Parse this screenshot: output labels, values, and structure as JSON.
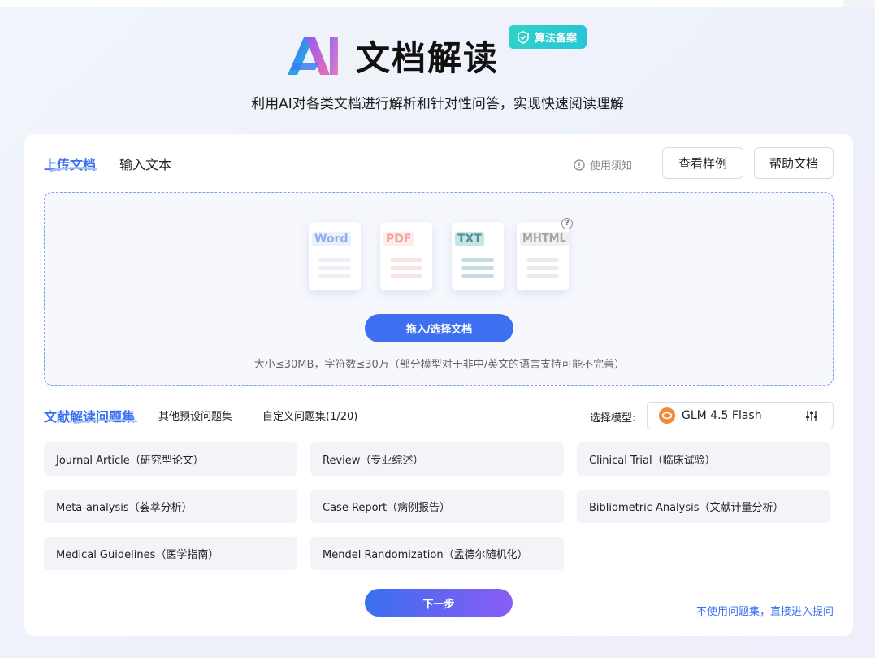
{
  "header": {
    "title": "文档解读",
    "badge": "算法备案",
    "subtitle": "利用AI对各类文档进行解析和针对性问答，实现快速阅读理解"
  },
  "tabs": {
    "upload": "上传文档",
    "input_text": "输入文本"
  },
  "toolbar": {
    "notice": "使用须知",
    "examples": "查看样例",
    "help": "帮助文档"
  },
  "upload": {
    "file_types": [
      "Word",
      "PDF",
      "TXT",
      "MHTML"
    ],
    "button": "拖入/选择文档",
    "hint": "大小≤30MB，字符数≤30万（部分模型对于非中/英文的语言支持可能不完善）"
  },
  "question_tabs": {
    "literature": "文献解读问题集",
    "other": "其他预设问题集",
    "custom": "自定义问题集(1/20)"
  },
  "model": {
    "label": "选择模型:",
    "selected": "GLM 4.5 Flash"
  },
  "questions": [
    "Journal Article（研究型论文）",
    "Review（专业综述）",
    "Clinical Trial（临床试验）",
    "Meta-analysis（荟萃分析）",
    "Case Report（病例报告）",
    "Bibliometric Analysis（文献计量分析）",
    "Medical Guidelines（医学指南）",
    "Mendel Randomization（孟德尔随机化）"
  ],
  "actions": {
    "next": "下一步",
    "skip": "不使用问题集，直接进入提问"
  },
  "colors": {
    "accent": "#3a6ff2",
    "badge": "#2fd2c8"
  }
}
